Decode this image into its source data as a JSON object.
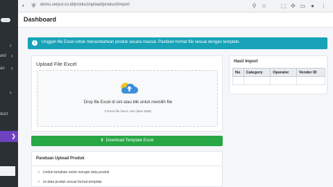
{
  "browser": {
    "url": "demo.serpul.co.id/product/upload/product/import"
  },
  "sidebar": {
    "badge": "...",
    "item_a": "ard",
    "item_b": "an",
    "item_c": "duct",
    "active_chevron": "❯"
  },
  "navbar": {
    "title": "Dashboard"
  },
  "alert": {
    "text": "Unggah file Excel untuk menambahkan produk secara massal. Pastikan format file sesuai dengan template."
  },
  "upload": {
    "heading": "Upload File Excel",
    "drop_text": "Drop file Excel di sini atau klik untuk memilih file",
    "format_text": "Format file harus .xlsx (Max 5MB)"
  },
  "download_button": {
    "label": "Download Template Excel"
  },
  "guide": {
    "heading": "Panduan Upload Produk",
    "items": [
      "Unduh template untuk mengisi data produk",
      "Isi data produk sesuai format template"
    ]
  },
  "result": {
    "heading": "Hasil Import",
    "columns": [
      "No",
      "Category",
      "Operator",
      "Vendor ID"
    ]
  },
  "colors": {
    "alert": "#17a2b8",
    "success": "#28a745",
    "sidebar": "#2b3035",
    "sidebar_active": "#6f42c1"
  }
}
